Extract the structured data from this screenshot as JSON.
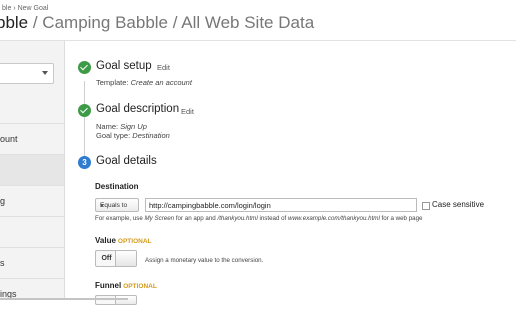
{
  "breadcrumb": {
    "part1": "ble",
    "separator": "›",
    "part2": "New Goal"
  },
  "header": {
    "title_strong": "bble",
    "title_rest": " / Camping Babble / All Web Site Data"
  },
  "sidebar": {
    "items": [
      {
        "label": "ount"
      },
      {
        "label": ""
      },
      {
        "label": "g"
      },
      {
        "label": ""
      },
      {
        "label": "s"
      },
      {
        "label": "ings"
      }
    ]
  },
  "steps": {
    "setup": {
      "title": "Goal setup",
      "edit": "Edit",
      "template_label": "Template:",
      "template_value": "Create an account"
    },
    "description": {
      "title": "Goal description",
      "edit": "Edit",
      "name_label": "Name:",
      "name_value": "Sign Up",
      "type_label": "Goal type:",
      "type_value": "Destination"
    },
    "details": {
      "number": "3",
      "title": "Goal details"
    }
  },
  "destination": {
    "label": "Destination",
    "match_type": "Equals to",
    "url": "http://campingbabble.com/login/login",
    "case_sensitive_label": "Case sensitive",
    "case_sensitive_checked": false,
    "hint_prefix": "For example, use ",
    "hint_my_screen": "My Screen",
    "hint_mid": " for an app and ",
    "hint_path": "/thankyou.html",
    "hint_mid2": " instead of ",
    "hint_url": "www.example.com/thankyou.html",
    "hint_suffix": " for a web page"
  },
  "value": {
    "label": "Value",
    "optional": "OPTIONAL",
    "toggle_state": "Off",
    "description": "Assign a monetary value to the conversion."
  },
  "funnel": {
    "label": "Funnel",
    "optional": "OPTIONAL"
  },
  "colors": {
    "check_green": "#3d9a47",
    "step_blue": "#2e7bcf",
    "optional_orange": "#d39a1a"
  }
}
